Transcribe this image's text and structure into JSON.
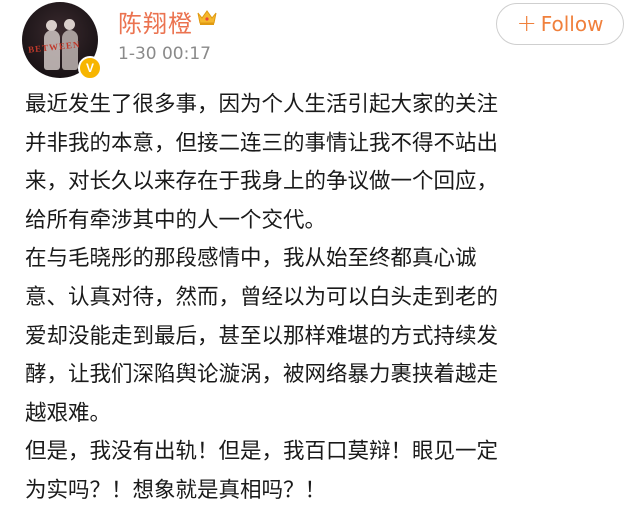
{
  "author": {
    "name": "陈翔橙",
    "avatar_watermark": "BETWEEN",
    "verified_badge": "V",
    "member_icon": "crown-icon",
    "colors": {
      "name": "#eb7350",
      "badge": "#f7b500"
    }
  },
  "post_meta": {
    "time": "1-30 00:17"
  },
  "follow_button": {
    "icon": "plus-icon",
    "label": "Follow",
    "color": "#f0803c"
  },
  "post": {
    "paragraphs": [
      "最近发生了很多事，因为个人生活引起大家的关注\n并非我的本意，但接二连三的事情让我不得不站出\n来，对长久以来存在于我身上的争议做一个回应，\n给所有牵涉其中的人一个交代。",
      "在与毛晓彤的那段感情中，我从始至终都真心诚\n意、认真对待，然而，曾经以为可以白头走到老的\n爱却没能走到最后，甚至以那样难堪的方式持续发\n酵，让我们深陷舆论漩涡，被网络暴力裹挟着越走\n越艰难。",
      "但是，我没有出轨！但是，我百口莫辩！眼见一定\n为实吗？！想象就是真相吗？！"
    ]
  }
}
